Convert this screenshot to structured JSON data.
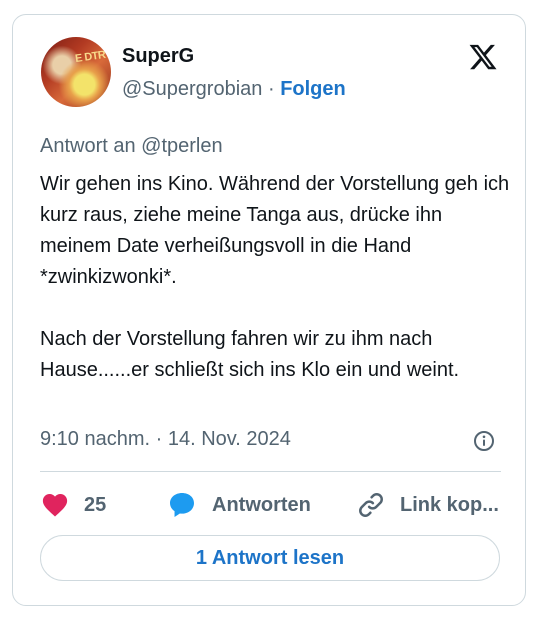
{
  "tweet": {
    "author_name": "SuperG",
    "handle": "@Supergrobian",
    "separator": "·",
    "follow_label": "Folgen",
    "reply_to": "Antwort an @tperlen",
    "text": "Wir gehen ins Kino. Während der Vorstellung geh ich kurz raus, ziehe meine Tanga aus, drücke ihn meinem Date verheißungsvoll in die Hand *zwinkizwonki*.\n\nNach der Vorstellung fahren wir zu ihm nach Hause......er schließt sich ins Klo ein und weint.",
    "timestamp": "9:10 nachm. · 14. Nov. 2024"
  },
  "actions": {
    "like_count": "25",
    "reply_label": "Antworten",
    "copy_link_label": "Link kop..."
  },
  "read_replies_label": "1 Antwort lesen",
  "colors": {
    "heart": "#e0245e",
    "reply_bubble": "#1d9bf0",
    "link_blue": "#1d74c8",
    "secondary_text": "#536471",
    "border": "#cfd9de"
  },
  "icons": [
    "x-logo-icon",
    "info-icon",
    "heart-icon",
    "reply-bubble-icon",
    "link-icon"
  ]
}
